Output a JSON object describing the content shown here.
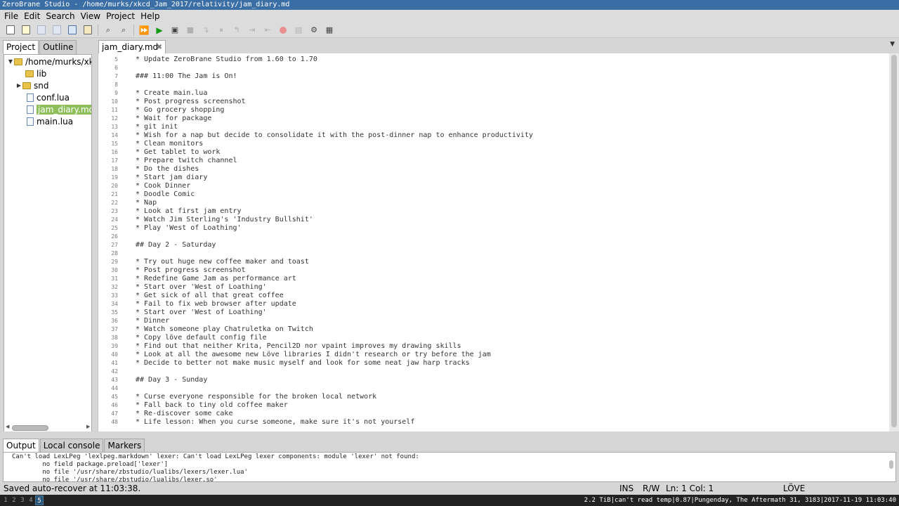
{
  "window": {
    "title": "ZeroBrane Studio - /home/murks/xkcd_Jam_2017/relativity/jam_diary.md"
  },
  "menu": [
    "File",
    "Edit",
    "Search",
    "View",
    "Project",
    "Help"
  ],
  "toolbar": {
    "buttons": [
      "new-file-icon",
      "open-file-icon",
      "save-icon",
      "save-all-icon",
      "project-directory-icon",
      "settings-icon",
      "find-icon",
      "find-in-files-icon",
      "run-project-icon",
      "start-debug-icon",
      "compile-icon",
      "stop-icon",
      "step-into-icon",
      "step-over-icon",
      "step-out-icon",
      "run-to-cursor-icon",
      "break-icon",
      "toggle-breakpoint-icon",
      "stack-window-icon",
      "watch-window-icon"
    ]
  },
  "left_panel": {
    "tabs": [
      "Project",
      "Outline"
    ],
    "active_tab": "Project",
    "tree": [
      {
        "label": "/home/murks/xkcd",
        "type": "folder",
        "expanded": true
      },
      {
        "label": "lib",
        "type": "folder"
      },
      {
        "label": "snd",
        "type": "folder",
        "collapsed": true
      },
      {
        "label": "conf.lua",
        "type": "file"
      },
      {
        "label": "jam_diary.md",
        "type": "file",
        "selected": true
      },
      {
        "label": "main.lua",
        "type": "file"
      }
    ]
  },
  "editor": {
    "tab_label": "jam_diary.md",
    "close_glyph": "✖",
    "lines": [
      {
        "n": "5",
        "text": "* Update ZeroBrane Studio from 1.60 to 1.70"
      },
      {
        "n": "6",
        "text": ""
      },
      {
        "n": "7",
        "text": "### 11:00 The Jam is On!"
      },
      {
        "n": "8",
        "text": ""
      },
      {
        "n": "9",
        "text": "* Create main.lua"
      },
      {
        "n": "10",
        "text": "* Post progress screenshot"
      },
      {
        "n": "11",
        "text": "* Go grocery shopping"
      },
      {
        "n": "12",
        "text": "* Wait for package"
      },
      {
        "n": "13",
        "text": "* git init"
      },
      {
        "n": "14",
        "text": "* Wish for a nap but decide to consolidate it with the post-dinner nap to enhance productivity"
      },
      {
        "n": "15",
        "text": "* Clean monitors"
      },
      {
        "n": "16",
        "text": "* Get tablet to work"
      },
      {
        "n": "17",
        "text": "* Prepare twitch channel"
      },
      {
        "n": "18",
        "text": "* Do the dishes"
      },
      {
        "n": "19",
        "text": "* Start jam diary"
      },
      {
        "n": "20",
        "text": "* Cook Dinner"
      },
      {
        "n": "21",
        "text": "* Doodle Comic"
      },
      {
        "n": "22",
        "text": "* Nap"
      },
      {
        "n": "23",
        "text": "* Look at first jam entry"
      },
      {
        "n": "24",
        "text": "* Watch Jim Sterling's 'Industry Bullshit'"
      },
      {
        "n": "25",
        "text": "* Play 'West of Loathing'"
      },
      {
        "n": "26",
        "text": ""
      },
      {
        "n": "27",
        "text": "## Day 2 - Saturday"
      },
      {
        "n": "28",
        "text": ""
      },
      {
        "n": "29",
        "text": "* Try out huge new coffee maker and toast"
      },
      {
        "n": "30",
        "text": "* Post progress screenshot"
      },
      {
        "n": "31",
        "text": "* Redefine Game Jam as performance art"
      },
      {
        "n": "32",
        "text": "* Start over 'West of Loathing'"
      },
      {
        "n": "33",
        "text": "* Get sick of all that great coffee"
      },
      {
        "n": "34",
        "text": "* Fail to fix web browser after update"
      },
      {
        "n": "35",
        "text": "* Start over 'West of Loathing'"
      },
      {
        "n": "36",
        "text": "* Dinner"
      },
      {
        "n": "37",
        "text": "* Watch someone play Chatruletka on Twitch"
      },
      {
        "n": "38",
        "text": "* Copy löve default config file"
      },
      {
        "n": "39",
        "text": "* Find out that neither Krita, Pencil2D nor vpaint improves my drawing skills"
      },
      {
        "n": "40",
        "text": "* Look at all the awesome new Löve libraries I didn't research or try before the jam"
      },
      {
        "n": "41",
        "text": "* Decide to better not make music myself and look for some neat jaw harp tracks"
      },
      {
        "n": "42",
        "text": ""
      },
      {
        "n": "43",
        "text": "## Day 3 - Sunday"
      },
      {
        "n": "44",
        "text": ""
      },
      {
        "n": "45",
        "text": "* Curse everyone responsible for the broken local network"
      },
      {
        "n": "46",
        "text": "* Fall back to tiny old coffee maker"
      },
      {
        "n": "47",
        "text": "* Re-discover some cake"
      },
      {
        "n": "48",
        "text": "* Life lesson: When you curse someone, make sure it's not yourself"
      }
    ]
  },
  "bottom_panel": {
    "tabs": [
      "Output",
      "Local console",
      "Markers"
    ],
    "active_tab": "Output",
    "output_lines": [
      "Can't load LexLPeg 'lexlpeg.markdown' lexer: Can't load LexLPeg lexer components: module 'lexer' not found:",
      "        no field package.preload['lexer']",
      "        no file '/usr/share/zbstudio/lualibs/lexers/lexer.lua'",
      "        no file '/usr/share/zbstudio/lualibs/lexer.so'"
    ]
  },
  "statusbar": {
    "message": "Saved auto-recover at 11:03:38.",
    "mode": "INS",
    "access": "R/W",
    "position": "Ln: 1 Col: 1",
    "interpreter": "LÖVE"
  },
  "taskbar": {
    "workspaces": [
      "1",
      "2",
      "3",
      "4",
      "5"
    ],
    "active_workspace": "5",
    "tray": "2.2 TiB|can't read temp|0.87|Pungenday, The Aftermath 31, 3183|2017-11-19 11:03:40"
  }
}
